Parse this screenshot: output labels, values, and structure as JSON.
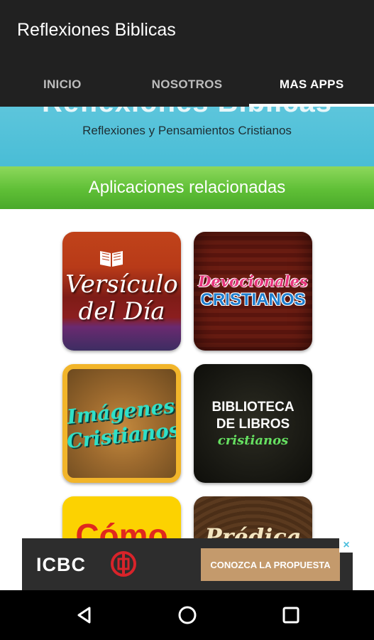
{
  "app": {
    "title": "Reflexiones Biblicas"
  },
  "tabs": [
    {
      "label": "INICIO",
      "active": false
    },
    {
      "label": "NOSOTROS",
      "active": false
    },
    {
      "label": "MAS APPS",
      "active": true
    }
  ],
  "banner": {
    "title": "Reflexiones Biblicas",
    "subtitle": "Reflexiones y Pensamientos Cristianos"
  },
  "section": {
    "title": "Aplicaciones relacionadas"
  },
  "apps": [
    {
      "line1": "Versículo",
      "line2": "del Día"
    },
    {
      "line1": "Devocionales",
      "line2": "CRISTIANOS"
    },
    {
      "line1": "Imágenes",
      "line2": "Cristianos"
    },
    {
      "line1": "BIBLIOTECA",
      "line2": "DE LIBROS",
      "line3": "cristianos"
    },
    {
      "line1": "Cómo"
    },
    {
      "line1": "Prédica"
    }
  ],
  "ad": {
    "brand": "ICBC",
    "cta": "CONOZCA LA PROPUESTA",
    "close": "×"
  },
  "colors": {
    "appbar": "#212121",
    "banner": "#4ec0de",
    "section_bar": "#6cc63f",
    "ad_cta": "#c49a6c"
  },
  "icons": {
    "nav_back": "back-triangle-icon",
    "nav_home": "home-circle-icon",
    "nav_recents": "recents-square-icon"
  }
}
